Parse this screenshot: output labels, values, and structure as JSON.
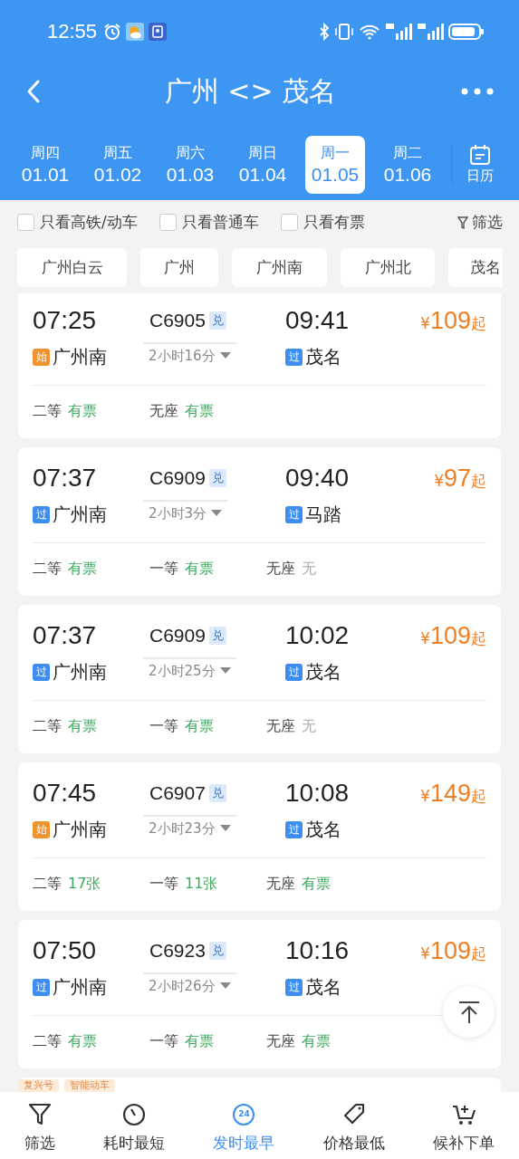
{
  "status_bar": {
    "time": "12:55"
  },
  "header": {
    "title": "广州 <> 茂名"
  },
  "date_tabs": [
    {
      "weekday": "周四",
      "date": "01.01",
      "selected": false
    },
    {
      "weekday": "周五",
      "date": "01.02",
      "selected": false
    },
    {
      "weekday": "周六",
      "date": "01.03",
      "selected": false
    },
    {
      "weekday": "周日",
      "date": "01.04",
      "selected": false
    },
    {
      "weekday": "周一",
      "date": "01.05",
      "selected": true
    },
    {
      "weekday": "周二",
      "date": "01.06",
      "selected": false
    }
  ],
  "calendar_button": {
    "label": "日历"
  },
  "filters": [
    {
      "label": "只看高铁/动车",
      "checked": false
    },
    {
      "label": "只看普通车",
      "checked": false
    },
    {
      "label": "只看有票",
      "checked": false
    }
  ],
  "filter_button": {
    "label": "筛选"
  },
  "stations": [
    "广州白云",
    "广州",
    "广州南",
    "广州北",
    "茂名"
  ],
  "trains": [
    {
      "depart": "07:25",
      "train": "C6905",
      "tag": "兑",
      "arrive": "09:41",
      "price_symbol": "¥",
      "price": "109",
      "price_suffix": "起",
      "from_badge": {
        "kind": "origin",
        "label": "始"
      },
      "from": "广州南",
      "duration": "2小时16分",
      "to_badge": {
        "kind": "pass",
        "label": "过"
      },
      "to": "茂名",
      "seats": [
        {
          "class": "二等",
          "availability": "有票",
          "available": true
        },
        {
          "class": "无座",
          "availability": "有票",
          "available": true
        }
      ]
    },
    {
      "depart": "07:37",
      "train": "C6909",
      "tag": "兑",
      "arrive": "09:40",
      "price_symbol": "¥",
      "price": "97",
      "price_suffix": "起",
      "from_badge": {
        "kind": "pass",
        "label": "过"
      },
      "from": "广州南",
      "duration": "2小时3分",
      "to_badge": {
        "kind": "pass",
        "label": "过"
      },
      "to": "马踏",
      "seats": [
        {
          "class": "二等",
          "availability": "有票",
          "available": true
        },
        {
          "class": "一等",
          "availability": "有票",
          "available": true
        },
        {
          "class": "无座",
          "availability": "无",
          "available": false
        }
      ]
    },
    {
      "depart": "07:37",
      "train": "C6909",
      "tag": "兑",
      "arrive": "10:02",
      "price_symbol": "¥",
      "price": "109",
      "price_suffix": "起",
      "from_badge": {
        "kind": "pass",
        "label": "过"
      },
      "from": "广州南",
      "duration": "2小时25分",
      "to_badge": {
        "kind": "pass",
        "label": "过"
      },
      "to": "茂名",
      "seats": [
        {
          "class": "二等",
          "availability": "有票",
          "available": true
        },
        {
          "class": "一等",
          "availability": "有票",
          "available": true
        },
        {
          "class": "无座",
          "availability": "无",
          "available": false
        }
      ]
    },
    {
      "depart": "07:45",
      "train": "C6907",
      "tag": "兑",
      "arrive": "10:08",
      "price_symbol": "¥",
      "price": "149",
      "price_suffix": "起",
      "from_badge": {
        "kind": "origin",
        "label": "始"
      },
      "from": "广州南",
      "duration": "2小时23分",
      "to_badge": {
        "kind": "pass",
        "label": "过"
      },
      "to": "茂名",
      "seats": [
        {
          "class": "二等",
          "availability": "17张",
          "available": true
        },
        {
          "class": "一等",
          "availability": "11张",
          "available": true
        },
        {
          "class": "无座",
          "availability": "有票",
          "available": true
        }
      ]
    },
    {
      "depart": "07:50",
      "train": "C6923",
      "tag": "兑",
      "arrive": "10:16",
      "price_symbol": "¥",
      "price": "109",
      "price_suffix": "起",
      "from_badge": {
        "kind": "pass",
        "label": "过"
      },
      "from": "广州南",
      "duration": "2小时26分",
      "to_badge": {
        "kind": "pass",
        "label": "过"
      },
      "to": "茂名",
      "seats": [
        {
          "class": "二等",
          "availability": "有票",
          "available": true
        },
        {
          "class": "一等",
          "availability": "有票",
          "available": true
        },
        {
          "class": "无座",
          "availability": "有票",
          "available": true
        }
      ]
    }
  ],
  "next_card_tags": [
    "复兴号",
    "智能动车"
  ],
  "bottom_nav": [
    {
      "kind": "filter",
      "label": "筛选",
      "selected": false
    },
    {
      "kind": "duration",
      "label": "耗时最短",
      "selected": false
    },
    {
      "kind": "depart",
      "label": "发时最早",
      "icon_text": "24",
      "selected": true
    },
    {
      "kind": "price",
      "label": "价格最低",
      "selected": false
    },
    {
      "kind": "waitlist",
      "label": "候补下单",
      "selected": false
    }
  ]
}
